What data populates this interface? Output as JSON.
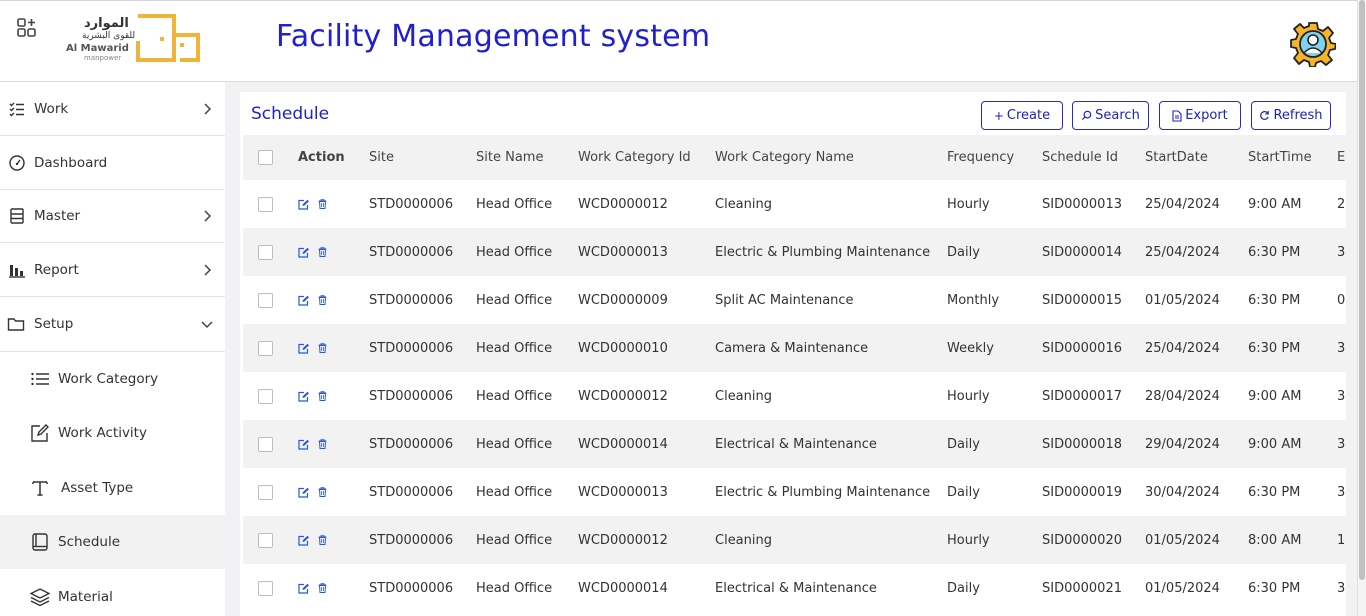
{
  "header": {
    "logo_ar_line1": "الموارد",
    "logo_ar_line2": "للقوى البشرية",
    "logo_en_line1": "Al Mawarid",
    "logo_en_line2": "manpower",
    "title": "Facility Management system",
    "apps_icon": "grid-plus-icon",
    "settings_icon": "user-gear-icon"
  },
  "sidebar": {
    "items": [
      {
        "label": "Work",
        "icon": "list-check-icon",
        "chevron": "right"
      },
      {
        "label": "Dashboard",
        "icon": "gauge-icon",
        "chevron": ""
      },
      {
        "label": "Master",
        "icon": "database-icon",
        "chevron": "right"
      },
      {
        "label": "Report",
        "icon": "bar-chart-icon",
        "chevron": "right"
      },
      {
        "label": "Setup",
        "icon": "folder-icon",
        "chevron": "down"
      }
    ],
    "sub_items": [
      {
        "label": "Work Category",
        "icon": "list-icon"
      },
      {
        "label": "Work Activity",
        "icon": "edit-icon"
      },
      {
        "label": "Asset Type",
        "icon": "text-icon"
      },
      {
        "label": "Schedule",
        "icon": "book-icon",
        "active": true
      },
      {
        "label": "Material",
        "icon": "layers-icon"
      }
    ]
  },
  "panel": {
    "title": "Schedule",
    "buttons": {
      "create": "Create",
      "search": "Search",
      "export": "Export",
      "refresh": "Refresh"
    }
  },
  "table": {
    "columns": [
      "",
      "Action",
      "Site",
      "Site Name",
      "Work Category Id",
      "Work Category Name",
      "Frequency",
      "Schedule Id",
      "StartDate",
      "StartTime",
      "E"
    ],
    "rows": [
      [
        "STD0000006",
        "Head Office",
        "WCD0000012",
        "Cleaning",
        "Hourly",
        "SID0000013",
        "25/04/2024",
        "9:00 AM",
        "2"
      ],
      [
        "STD0000006",
        "Head Office",
        "WCD0000013",
        "Electric & Plumbing Maintenance",
        "Daily",
        "SID0000014",
        "25/04/2024",
        "6:30 PM",
        "3"
      ],
      [
        "STD0000006",
        "Head Office",
        "WCD0000009",
        "Split AC Maintenance",
        "Monthly",
        "SID0000015",
        "01/05/2024",
        "6:30 PM",
        "0"
      ],
      [
        "STD0000006",
        "Head Office",
        "WCD0000010",
        "Camera & Maintenance",
        "Weekly",
        "SID0000016",
        "25/04/2024",
        "6:30 PM",
        "3"
      ],
      [
        "STD0000006",
        "Head Office",
        "WCD0000012",
        "Cleaning",
        "Hourly",
        "SID0000017",
        "28/04/2024",
        "9:00 AM",
        "3"
      ],
      [
        "STD0000006",
        "Head Office",
        "WCD0000014",
        "Electrical & Maintenance",
        "Daily",
        "SID0000018",
        "29/04/2024",
        "9:00 AM",
        "3"
      ],
      [
        "STD0000006",
        "Head Office",
        "WCD0000013",
        "Electric & Plumbing Maintenance",
        "Daily",
        "SID0000019",
        "30/04/2024",
        "6:30 PM",
        "3"
      ],
      [
        "STD0000006",
        "Head Office",
        "WCD0000012",
        "Cleaning",
        "Hourly",
        "SID0000020",
        "01/05/2024",
        "8:00 AM",
        "1"
      ],
      [
        "STD0000006",
        "Head Office",
        "WCD0000014",
        "Electrical & Maintenance",
        "Daily",
        "SID0000021",
        "01/05/2024",
        "6:30 PM",
        "3"
      ]
    ]
  },
  "colors": {
    "accent": "#2020d0",
    "logo_gold": "#f2b33d",
    "action_blue": "#2a58d8"
  }
}
